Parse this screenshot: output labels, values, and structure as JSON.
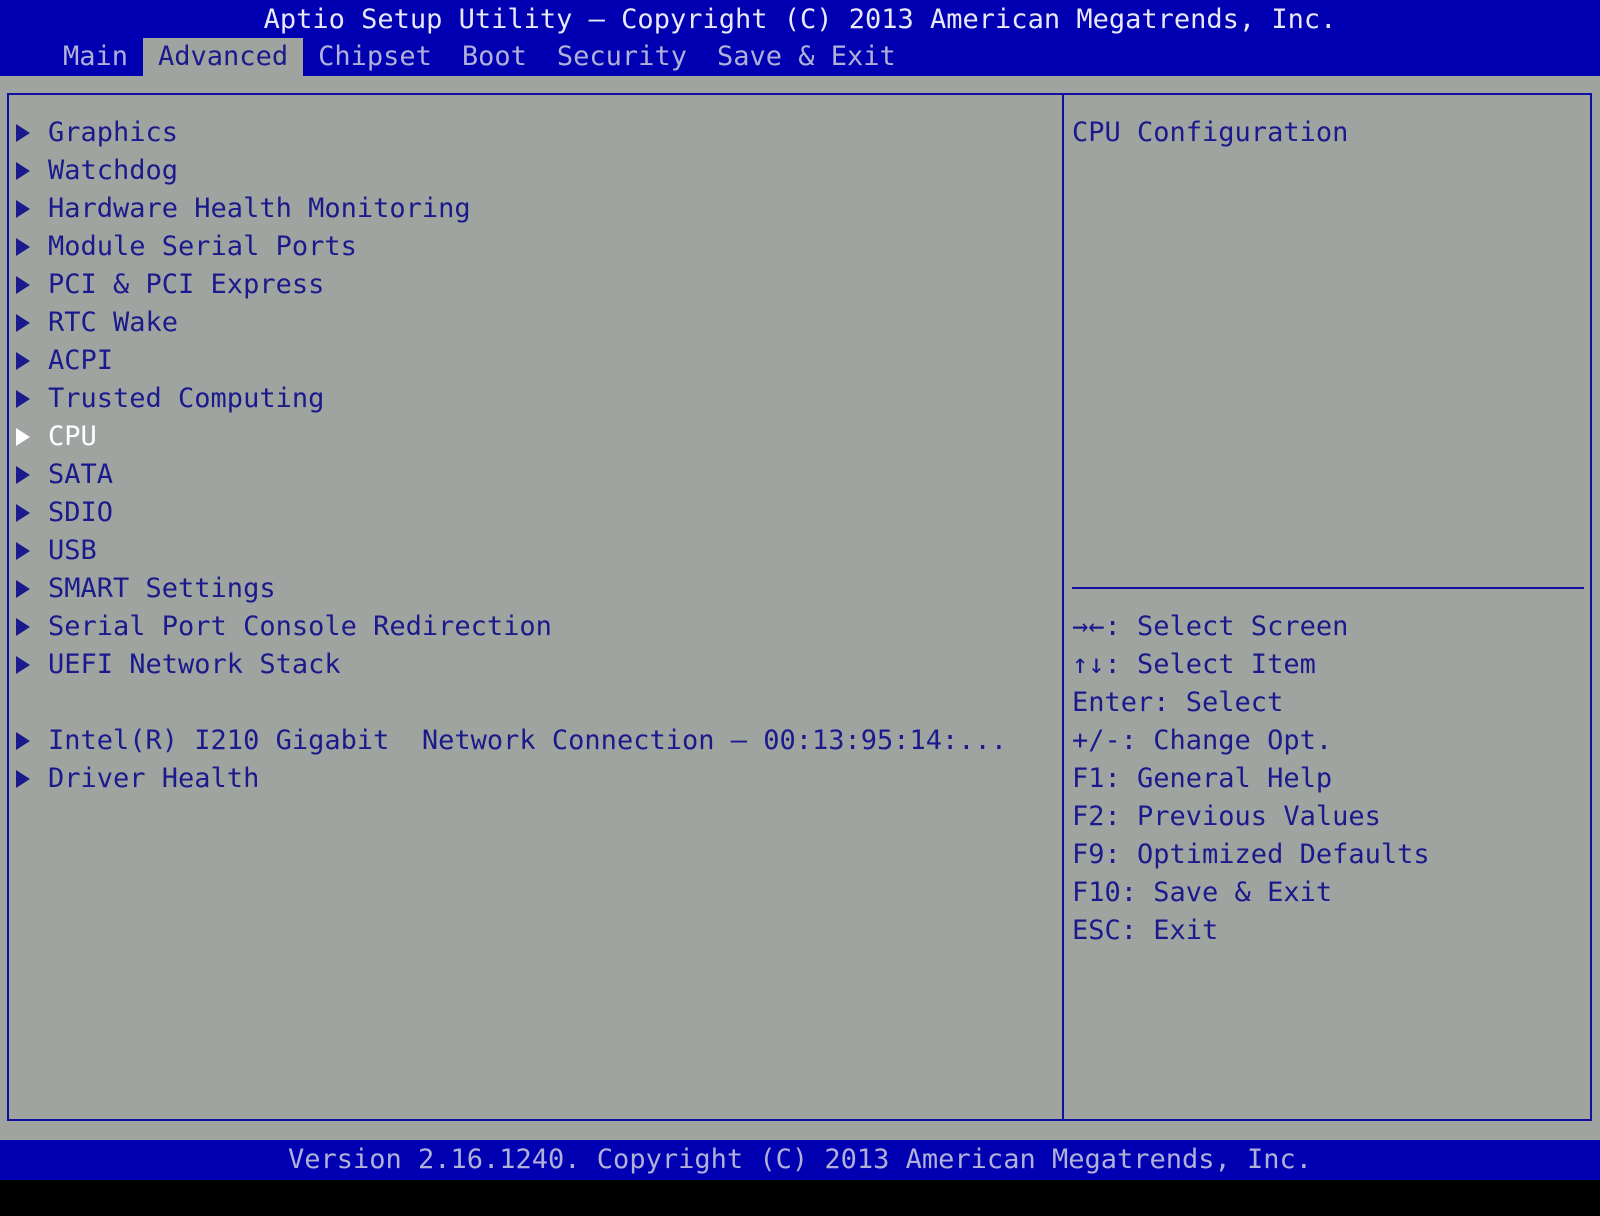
{
  "header": {
    "title": "Aptio Setup Utility – Copyright (C) 2013 American Megatrends, Inc.",
    "tabs": [
      {
        "label": "Main",
        "active": false
      },
      {
        "label": "Advanced",
        "active": true
      },
      {
        "label": "Chipset",
        "active": false
      },
      {
        "label": "Boot",
        "active": false
      },
      {
        "label": "Security",
        "active": false
      },
      {
        "label": "Save & Exit",
        "active": false
      }
    ]
  },
  "menu": {
    "items": [
      {
        "label": "Graphics"
      },
      {
        "label": "Watchdog"
      },
      {
        "label": "Hardware Health Monitoring"
      },
      {
        "label": "Module Serial Ports"
      },
      {
        "label": "PCI & PCI Express"
      },
      {
        "label": "RTC Wake"
      },
      {
        "label": "ACPI"
      },
      {
        "label": "Trusted Computing"
      },
      {
        "label": "CPU",
        "selected": true
      },
      {
        "label": "SATA"
      },
      {
        "label": "SDIO"
      },
      {
        "label": "USB"
      },
      {
        "label": "SMART Settings"
      },
      {
        "label": "Serial Port Console Redirection"
      },
      {
        "label": "UEFI Network Stack"
      },
      {
        "label": "Intel(R) I210 Gigabit  Network Connection – 00:13:95:14:..."
      },
      {
        "label": "Driver Health"
      }
    ]
  },
  "help": {
    "title": "CPU Configuration",
    "keys": [
      "→←: Select Screen",
      "↑↓: Select Item",
      "Enter: Select",
      "+/-: Change Opt.",
      "F1: General Help",
      "F2: Previous Values",
      "F9: Optimized Defaults",
      "F10: Save & Exit",
      "ESC: Exit"
    ]
  },
  "footer": {
    "text": "Version 2.16.1240. Copyright (C) 2013 American Megatrends, Inc."
  },
  "colors": {
    "header_blue": "#0000b2",
    "body_gray": "#a0a4a0",
    "text_blue": "#1a1a8c",
    "selected_white": "#ffffff"
  }
}
